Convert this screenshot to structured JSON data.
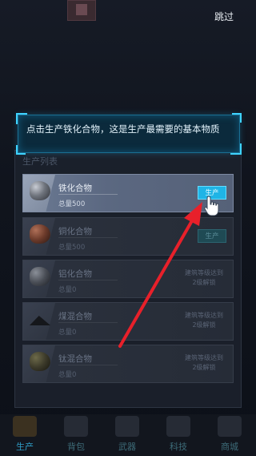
{
  "skip_label": "跳过",
  "tooltip": {
    "text": "点击生产铁化合物，这是生产最需要的基本物质"
  },
  "panel": {
    "title": "生产列表"
  },
  "items": [
    {
      "name": "铁化合物",
      "amount": "总量500",
      "action": "生产",
      "ore": "iron"
    },
    {
      "name": "铜化合物",
      "amount": "总量500",
      "action": "生产",
      "ore": "copper"
    },
    {
      "name": "铝化合物",
      "amount": "总量0",
      "lock_line1": "建筑等级达到",
      "lock_line2": "2级解锁",
      "ore": "alum"
    },
    {
      "name": "煤混合物",
      "amount": "总量0",
      "lock_line1": "建筑等级达到",
      "lock_line2": "2级解锁",
      "ore": "coal"
    },
    {
      "name": "钛混合物",
      "amount": "总量0",
      "lock_line1": "建筑等级达到",
      "lock_line2": "2级解锁",
      "ore": "ti"
    }
  ],
  "nav": [
    {
      "label": "生产",
      "icon": "gear-icon"
    },
    {
      "label": "背包",
      "icon": "bag-icon"
    },
    {
      "label": "武器",
      "icon": "weapon-icon"
    },
    {
      "label": "科技",
      "icon": "tech-icon"
    },
    {
      "label": "商城",
      "icon": "shop-icon"
    }
  ],
  "colors": {
    "accent": "#1fb4e6",
    "arrow": "#e8202a",
    "tooltip_border": "#3fd3ff"
  }
}
